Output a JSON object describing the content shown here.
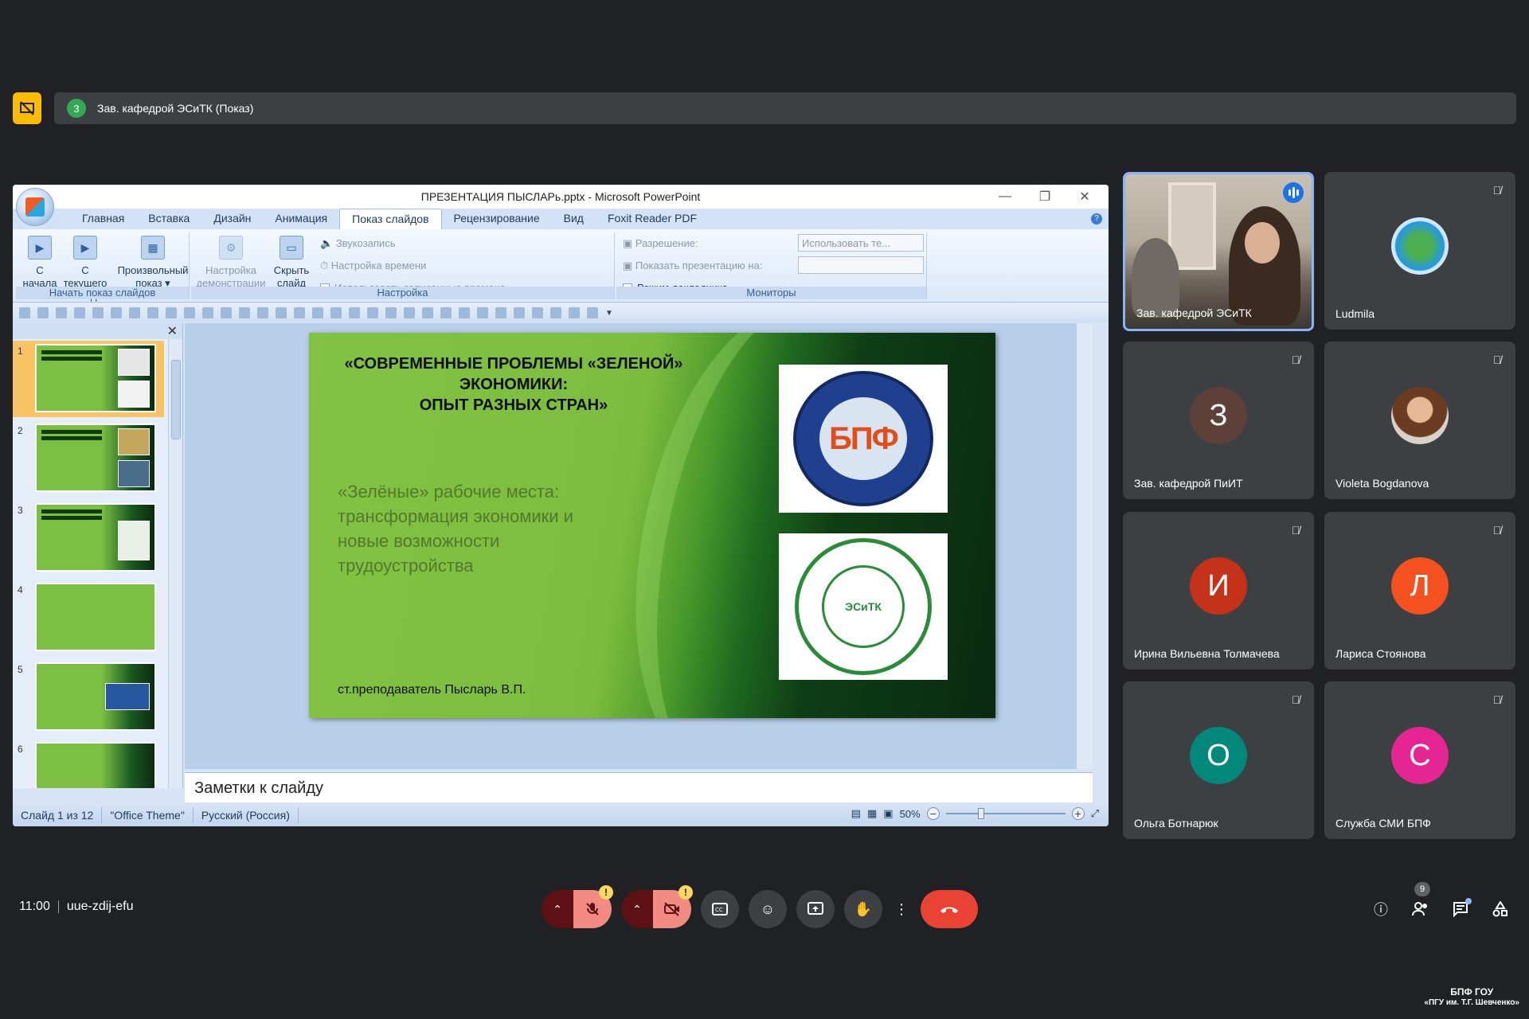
{
  "presenting": {
    "count": "3",
    "text": "Зав. кафедрой ЭСиТК (Показ)"
  },
  "ppt": {
    "title": "ПРЕЗЕНТАЦИЯ ПЫСЛАРь.pptx - Microsoft PowerPoint",
    "tabs": [
      "Главная",
      "Вставка",
      "Дизайн",
      "Анимация",
      "Показ слайдов",
      "Рецензирование",
      "Вид",
      "Foxit Reader PDF"
    ],
    "active_tab": "Показ слайдов",
    "groups": {
      "start": {
        "label": "Начать показ слайдов",
        "btn1": "С\nначала",
        "btn1a": "С",
        "btn1b": "начала",
        "btn2a": "С текущего",
        "btn2b": "слайда",
        "btn3a": "Произвольный",
        "btn3b": "показ ▾"
      },
      "setup": {
        "label": "Настройка",
        "btn1a": "Настройка",
        "btn1b": "демонстрации",
        "btn2a": "Скрыть",
        "btn2b": "слайд",
        "opt1": "Звукозапись",
        "opt2": "Настройка времени",
        "opt3": "Использовать записанные времена"
      },
      "monitors": {
        "label": "Мониторы",
        "opt1": "Разрешение:",
        "opt2": "Показать презентацию на:",
        "opt3": "Режим докладчика",
        "select1": "Использовать те..."
      }
    },
    "thumb_numbers": [
      "1",
      "2",
      "3",
      "4",
      "5",
      "6"
    ],
    "slide": {
      "title_l1": "«СОВРЕМЕННЫЕ ПРОБЛЕМЫ «ЗЕЛЕНОЙ»",
      "title_l2": "ЭКОНОМИКИ:",
      "title_l3": "ОПЫТ РАЗНЫХ СТРАН»",
      "subtitle": "«Зелёные» рабочие места: трансформация экономики и новые возможности трудоустройства",
      "author": "ст.преподаватель Пысларь В.П.",
      "logo1_text": "БПФ",
      "logo2_text": "ЭСиТК"
    },
    "notes": "Заметки к слайду",
    "status": {
      "slide": "Слайд 1 из 12",
      "theme": "\"Office Theme\"",
      "lang": "Русский (Россия)",
      "zoom": "50%"
    }
  },
  "participants": [
    {
      "name": "Зав. кафедрой ЭСиТК",
      "type": "video",
      "speaking": true
    },
    {
      "name": "Ludmila",
      "type": "globe"
    },
    {
      "name": "Зав. кафедрой ПиИТ",
      "initial": "З",
      "color": "#5d4037"
    },
    {
      "name": "Violeta Bogdanova",
      "type": "photo"
    },
    {
      "name": "Ирина Вильевна Толмачева",
      "initial": "И",
      "color": "#c5321a"
    },
    {
      "name": "Лариса Стоянова",
      "initial": "Л",
      "color": "#f4511e"
    },
    {
      "name": "Ольга Ботнарюк",
      "initial": "О",
      "color": "#00897b"
    },
    {
      "name": "Служба СМИ БПФ",
      "initial": "С",
      "color": "#e52592"
    }
  ],
  "meeting": {
    "time": "11:00",
    "code": "uue-zdij-efu",
    "people_count": "9"
  },
  "watermark": {
    "line1": "БПФ ГОУ",
    "line2": "«ПГУ им. Т.Г. Шевченко»"
  },
  "icons": {
    "present": "presentation-off-icon",
    "mic": "mic-off-icon",
    "cam": "videocam-off-icon",
    "captions": "captions-icon",
    "emoji": "emoji-icon",
    "share": "present-screen-icon",
    "hand": "raise-hand-icon",
    "more": "more-vert-icon",
    "hangup": "call-end-icon",
    "info": "info-icon",
    "people": "people-icon",
    "chat": "chat-icon",
    "activities": "activities-icon"
  },
  "colors": {
    "bg": "#202124",
    "tile": "#3c4043",
    "accent": "#8ab4f8",
    "hangup": "#ea4335",
    "present": "#fbbc04"
  }
}
